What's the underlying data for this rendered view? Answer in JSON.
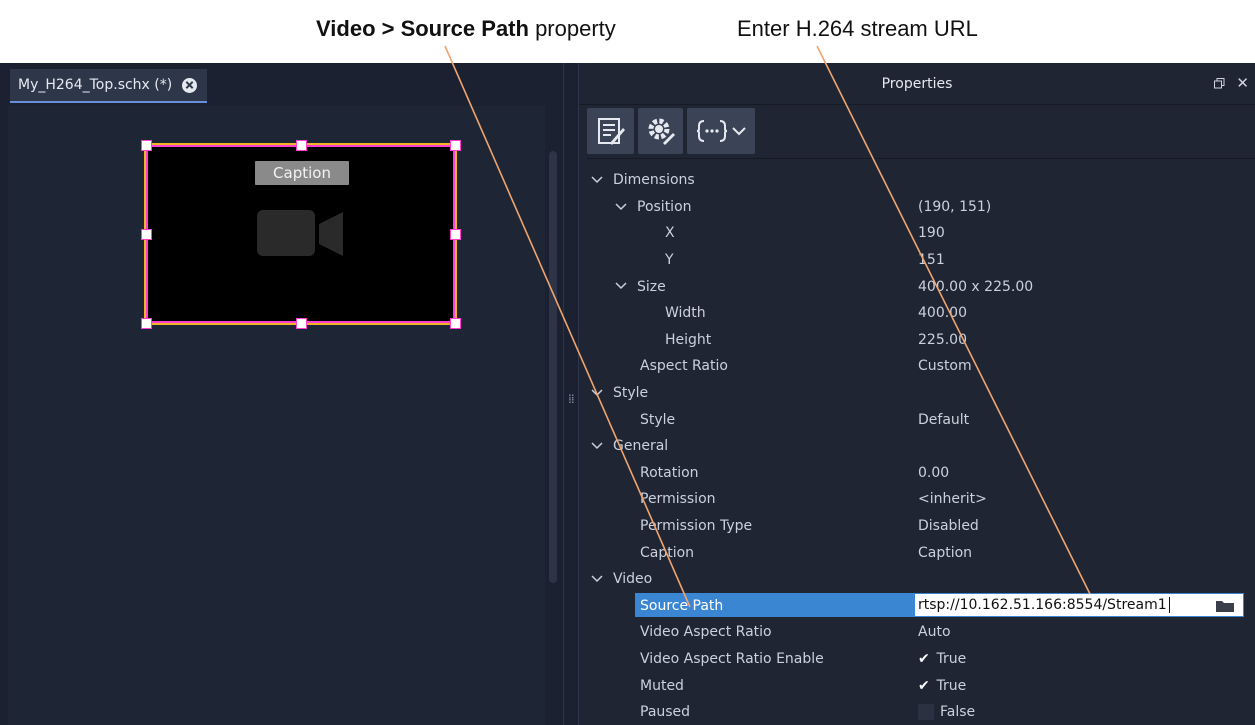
{
  "callouts": {
    "left_bold": "Video > Source Path",
    "left_rest": " property",
    "right": "Enter H.264 stream URL"
  },
  "editor": {
    "tab_title": "My_H264_Top.schx (*)",
    "caption_badge": "Caption"
  },
  "properties": {
    "title": "Properties",
    "rows": [
      {
        "label": "Dimensions",
        "value": "",
        "level": 0,
        "expander": true
      },
      {
        "label": "Position",
        "value": "(190, 151)",
        "level": 1,
        "expander": true
      },
      {
        "label": "X",
        "value": "190",
        "level": 3,
        "expander": false
      },
      {
        "label": "Y",
        "value": "151",
        "level": 3,
        "expander": false
      },
      {
        "label": "Size",
        "value": "400.00 x 225.00",
        "level": 1,
        "expander": true
      },
      {
        "label": "Width",
        "value": "400.00",
        "level": 3,
        "expander": false
      },
      {
        "label": "Height",
        "value": "225.00",
        "level": 3,
        "expander": false
      },
      {
        "label": "Aspect Ratio",
        "value": "Custom",
        "level": 2,
        "expander": false
      },
      {
        "label": "Style",
        "value": "",
        "level": 0,
        "expander": true
      },
      {
        "label": "Style",
        "value": "Default",
        "level": 2,
        "expander": false
      },
      {
        "label": "General",
        "value": "",
        "level": 0,
        "expander": true
      },
      {
        "label": "Rotation",
        "value": "0.00",
        "level": 2,
        "expander": false
      },
      {
        "label": "Permission",
        "value": "<inherit>",
        "level": 2,
        "expander": false
      },
      {
        "label": "Permission Type",
        "value": "Disabled",
        "level": 2,
        "expander": false
      },
      {
        "label": "Caption",
        "value": "Caption",
        "level": 2,
        "expander": false
      },
      {
        "label": "Video",
        "value": "",
        "level": 0,
        "expander": true
      },
      {
        "label": "Source Path",
        "value": "rtsp://10.162.51.166:8554/Stream1",
        "level": 2,
        "expander": false,
        "selected": true,
        "editing": true
      },
      {
        "label": "Video Aspect Ratio",
        "value": "Auto",
        "level": 2,
        "expander": false
      },
      {
        "label": "Video Aspect Ratio Enable",
        "value": "True",
        "level": 2,
        "expander": false,
        "checkbox": "checked"
      },
      {
        "label": "Muted",
        "value": "True",
        "level": 2,
        "expander": false,
        "checkbox": "checked"
      },
      {
        "label": "Paused",
        "value": "False",
        "level": 2,
        "expander": false,
        "checkbox": "unchecked"
      }
    ]
  },
  "icons": {
    "tab_close": "close-circle-icon",
    "restore": "restore-window-icon",
    "close": "close-icon",
    "edit": "edit-document-icon",
    "settings": "gear-edit-icon",
    "script": "braces-script-icon",
    "dropdown": "chevron-down-icon",
    "folder": "folder-icon",
    "camera": "video-camera-icon"
  },
  "colors": {
    "selection_outline": "#ff3fd1",
    "selection_glow": "#f3b326",
    "accent_blue": "#3b86d3",
    "leader_line": "#f0a46e"
  }
}
